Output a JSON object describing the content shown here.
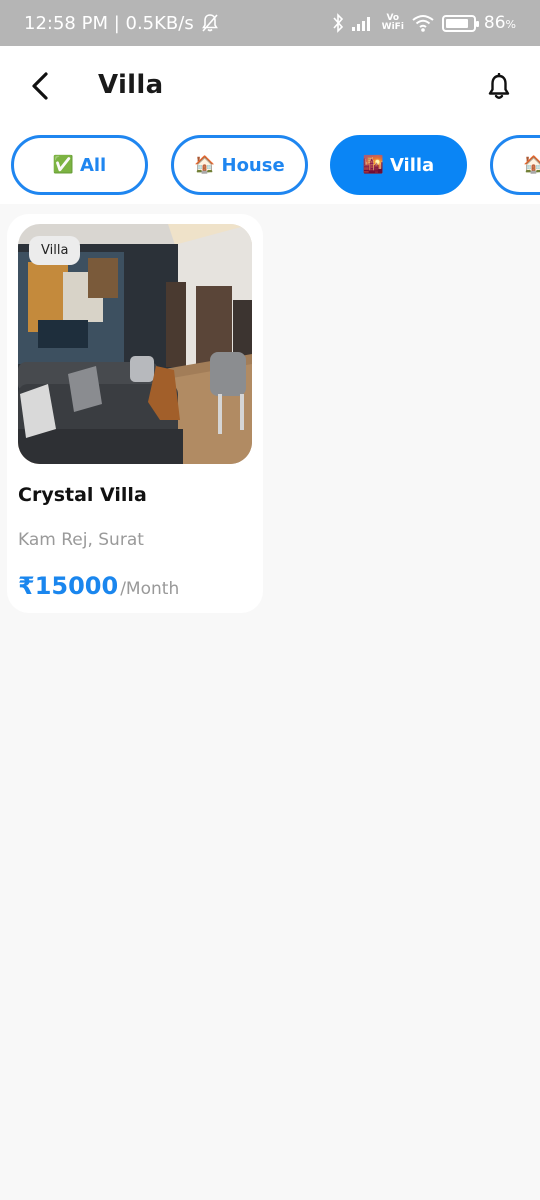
{
  "status_bar": {
    "time_speed": "12:58 PM | 0.5KB/s",
    "vowifi_top": "Vo",
    "vowifi_bottom": "WiFi",
    "battery_percent": 86,
    "battery_label": "86",
    "battery_sign": "%"
  },
  "header": {
    "title": "Villa",
    "back_icon": "chevron-left-icon",
    "notification_icon": "bell-icon"
  },
  "filters": [
    {
      "emoji": "✅",
      "label": "All",
      "active": false
    },
    {
      "emoji": "🏠",
      "label": "House",
      "active": false
    },
    {
      "emoji": "🌇",
      "label": "Villa",
      "active": true
    },
    {
      "emoji": "🏠",
      "label": "",
      "active": false
    }
  ],
  "listing": {
    "type_badge": "Villa",
    "name": "Crystal Villa",
    "location": "Kam Rej, Surat",
    "price": "₹15000",
    "price_unit": "/Month"
  },
  "colors": {
    "accent": "#0a85f5",
    "status_bar": "#b5b5b5",
    "background": "#f8f8f8"
  }
}
